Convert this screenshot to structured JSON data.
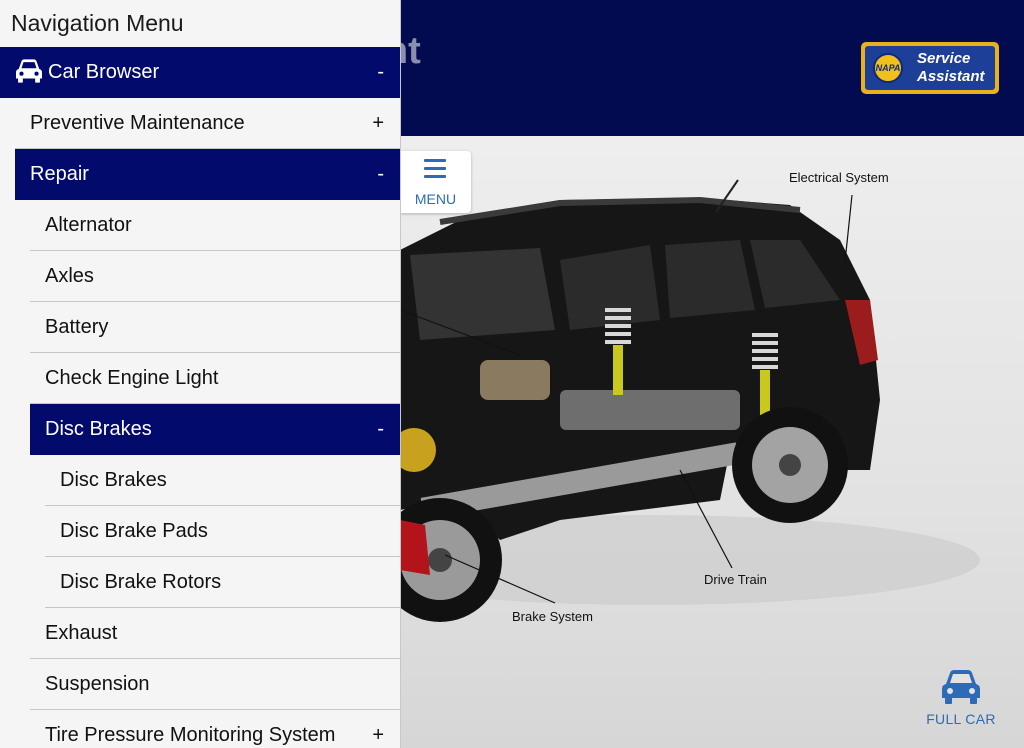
{
  "header": {
    "title": "Service Assistant",
    "title_visible": "stant"
  },
  "logo": {
    "badge": "NAPA",
    "line1": "Service",
    "line2": "Assistant"
  },
  "menu_button": {
    "label": "MENU",
    "icon": "hamburger-icon"
  },
  "full_car": {
    "label": "FULL CAR",
    "icon": "car-icon"
  },
  "callouts": {
    "electrical": "Electrical System",
    "drive_train": "Drive Train",
    "brake": "Brake System"
  },
  "nav": {
    "title": "Navigation Menu",
    "car_browser": {
      "label": "Car Browser",
      "sign": "-",
      "icon": "car-icon"
    },
    "preventive": {
      "label": "Preventive Maintenance",
      "sign": "+"
    },
    "repair": {
      "label": "Repair",
      "sign": "-"
    },
    "repair_items": {
      "alternator": "Alternator",
      "axles": "Axles",
      "battery": "Battery",
      "check_engine": "Check Engine Light",
      "disc_brakes": {
        "label": "Disc Brakes",
        "sign": "-"
      },
      "disc_children": [
        "Disc Brakes",
        "Disc Brake Pads",
        "Disc Brake Rotors"
      ],
      "exhaust": "Exhaust",
      "suspension": "Suspension",
      "tpms": {
        "label": "Tire Pressure Monitoring System",
        "sign": "+"
      }
    }
  },
  "colors": {
    "nav_active": "#020b6b",
    "header_bg": "#020b4f",
    "accent_blue": "#2d6bb6",
    "logo_gold": "#e9b21d"
  }
}
